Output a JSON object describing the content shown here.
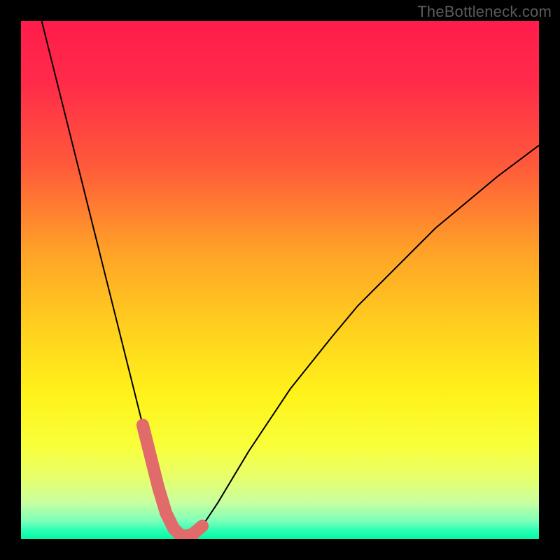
{
  "watermark": "TheBottleneck.com",
  "gradient_stops": [
    {
      "offset": 0.0,
      "color": "#ff1c4b"
    },
    {
      "offset": 0.12,
      "color": "#ff2b49"
    },
    {
      "offset": 0.28,
      "color": "#ff5a3a"
    },
    {
      "offset": 0.45,
      "color": "#ffa427"
    },
    {
      "offset": 0.6,
      "color": "#ffd21e"
    },
    {
      "offset": 0.72,
      "color": "#fff21a"
    },
    {
      "offset": 0.82,
      "color": "#f8ff3a"
    },
    {
      "offset": 0.88,
      "color": "#e8ff6a"
    },
    {
      "offset": 0.93,
      "color": "#c8ffa0"
    },
    {
      "offset": 0.965,
      "color": "#7dffb8"
    },
    {
      "offset": 0.985,
      "color": "#24ffb3"
    },
    {
      "offset": 1.0,
      "color": "#06f7a8"
    }
  ],
  "chart_data": {
    "type": "line",
    "title": "",
    "xlabel": "",
    "ylabel": "",
    "xlim": [
      0,
      100
    ],
    "ylim": [
      0,
      100
    ],
    "series": [
      {
        "name": "bottleneck-curve",
        "style": "thin-black",
        "x": [
          4,
          6,
          8,
          10,
          12,
          14,
          16,
          18,
          20,
          22,
          23.5,
          25,
          26.5,
          28,
          29.5,
          31,
          33,
          35,
          38,
          41,
          44,
          48,
          52,
          56,
          60,
          65,
          70,
          75,
          80,
          86,
          92,
          100
        ],
        "y": [
          100,
          92,
          84,
          76,
          68,
          60,
          52,
          44,
          36,
          28,
          22,
          16,
          10,
          5,
          2,
          0.5,
          0.8,
          2.5,
          7,
          12,
          17,
          23,
          29,
          34,
          39,
          45,
          50,
          55,
          60,
          65,
          70,
          76
        ]
      },
      {
        "name": "highlight-valley",
        "style": "thick-pink",
        "x": [
          23.5,
          25,
          26.5,
          28,
          29.5,
          31,
          33,
          35
        ],
        "y": [
          22,
          16,
          10,
          5,
          2,
          0.5,
          0.8,
          2.5
        ]
      }
    ]
  }
}
